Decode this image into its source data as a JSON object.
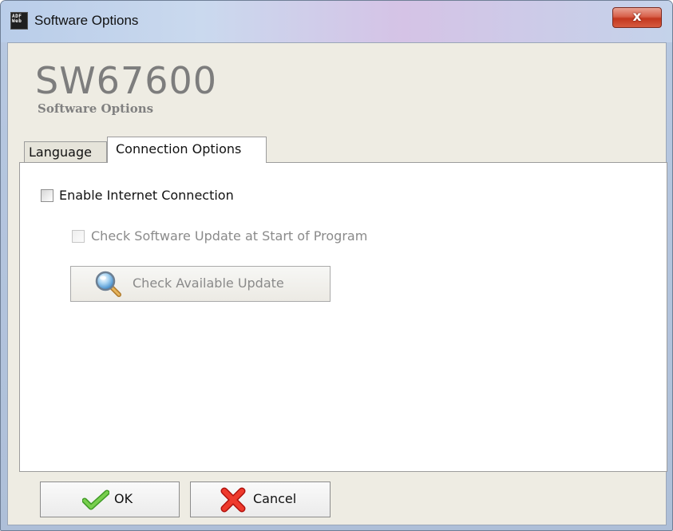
{
  "window": {
    "title": "Software Options",
    "app_icon_lines": [
      "ADF",
      "Web"
    ],
    "close_glyph": "x"
  },
  "header": {
    "product_name": "SW67600",
    "subtitle": "Software Options"
  },
  "tabs": [
    {
      "label": "Language",
      "selected": false
    },
    {
      "label": "Connection Options",
      "selected": true
    }
  ],
  "connection_options": {
    "enable_internet": {
      "label": "Enable Internet Connection",
      "checked": false,
      "enabled": true
    },
    "check_update_at_start": {
      "label": "Check Software Update at Start of Program",
      "checked": false,
      "enabled": false
    },
    "check_update_button": {
      "label": "Check Available Update",
      "enabled": false,
      "icon": "magnifier-icon"
    }
  },
  "footer": {
    "ok_label": "OK",
    "cancel_label": "Cancel",
    "ok_icon": "check-icon",
    "cancel_icon": "x-icon"
  },
  "colors": {
    "ok_check": "#5fb83c",
    "cancel_x": "#e2231a",
    "disabled_text": "#8a8a8a"
  }
}
